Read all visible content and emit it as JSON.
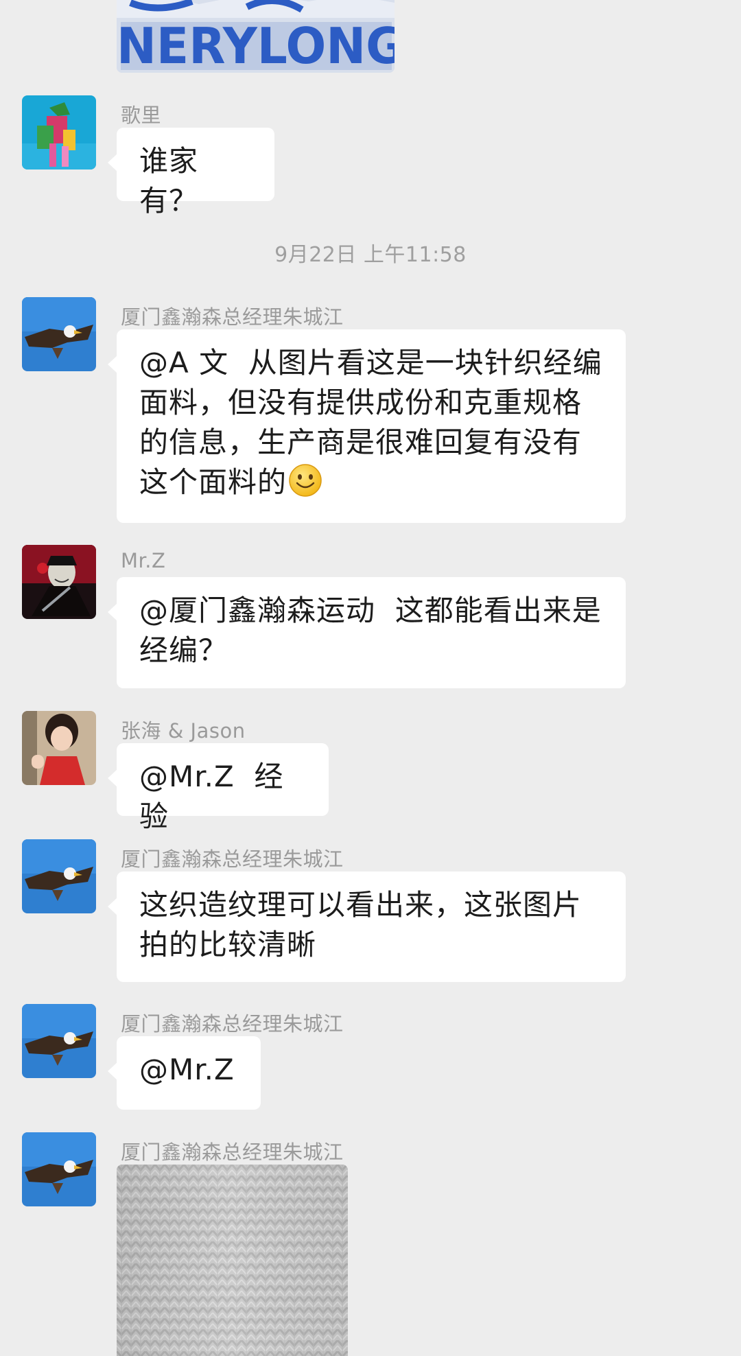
{
  "chat": {
    "top_image": {
      "visible_text": "NERYLONG"
    },
    "timestamp": "9月22日 上午11:58",
    "messages": [
      {
        "sender": "歌里",
        "text": "谁家有？"
      },
      {
        "sender": "厦门鑫瀚森总经理朱城江",
        "text": "@A 文  从图片看这是一块针织经编面料，但没有提供成份和克重规格的信息，生产商是很难回复有没有这个面料的",
        "emoji": "smile-emoji"
      },
      {
        "sender": "Mr.Z",
        "text": "@厦门鑫瀚森运动  这都能看出来是经编？"
      },
      {
        "sender": "张海 & Jason",
        "text": "@Mr.Z  经验"
      },
      {
        "sender": "厦门鑫瀚森总经理朱城江",
        "text": "这织造纹理可以看出来，这张图片拍的比较清晰"
      },
      {
        "sender": "厦门鑫瀚森总经理朱城江",
        "text": "@Mr.Z"
      },
      {
        "sender": "厦门鑫瀚森总经理朱城江",
        "image": "knit-fabric-photo"
      }
    ]
  },
  "colors": {
    "background": "#ededed",
    "bubble": "#ffffff",
    "sender_name": "#9a9a9a",
    "timestamp": "#9f9f9f",
    "text": "#1c1c1c"
  }
}
